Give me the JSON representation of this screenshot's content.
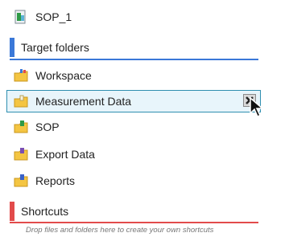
{
  "sop_item": {
    "label": "SOP_1",
    "icon": "document-icon"
  },
  "target_folders": {
    "title": "Target folders",
    "accent": "#3a78d8",
    "items": [
      {
        "label": "Workspace",
        "icon": "folder-workspace-icon"
      },
      {
        "label": "Measurement Data",
        "icon": "folder-icon",
        "selected": true
      },
      {
        "label": "SOP",
        "icon": "folder-sop-icon"
      },
      {
        "label": "Export Data",
        "icon": "folder-export-icon"
      },
      {
        "label": "Reports",
        "icon": "folder-reports-icon"
      }
    ]
  },
  "shortcuts": {
    "title": "Shortcuts",
    "accent": "#e24b4b",
    "hint": "Drop files and folders here to create your own shortcuts"
  }
}
